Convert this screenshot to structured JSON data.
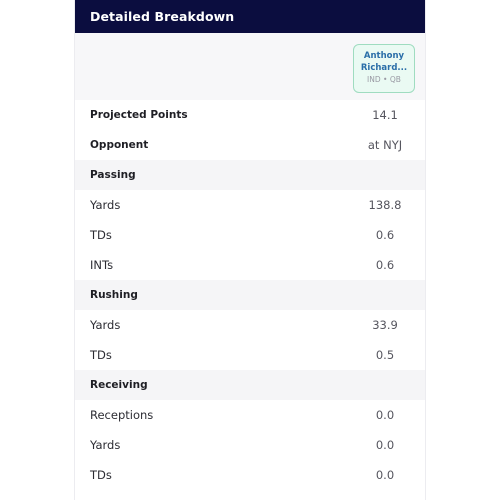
{
  "card": {
    "title": "Detailed Breakdown"
  },
  "player": {
    "name_line1": "Anthony",
    "name_line2": "Richard...",
    "team": "IND",
    "separator": "•",
    "position": "QB"
  },
  "summary": [
    {
      "label": "Projected Points",
      "value": "14.1"
    },
    {
      "label": "Opponent",
      "value": "at NYJ"
    }
  ],
  "sections": [
    {
      "title": "Passing",
      "rows": [
        {
          "label": "Yards",
          "value": "138.8"
        },
        {
          "label": "TDs",
          "value": "0.6"
        },
        {
          "label": "INTs",
          "value": "0.6"
        }
      ]
    },
    {
      "title": "Rushing",
      "rows": [
        {
          "label": "Yards",
          "value": "33.9"
        },
        {
          "label": "TDs",
          "value": "0.5"
        }
      ]
    },
    {
      "title": "Receiving",
      "rows": [
        {
          "label": "Receptions",
          "value": "0.0"
        },
        {
          "label": "Yards",
          "value": "0.0"
        },
        {
          "label": "TDs",
          "value": "0.0"
        }
      ]
    }
  ]
}
